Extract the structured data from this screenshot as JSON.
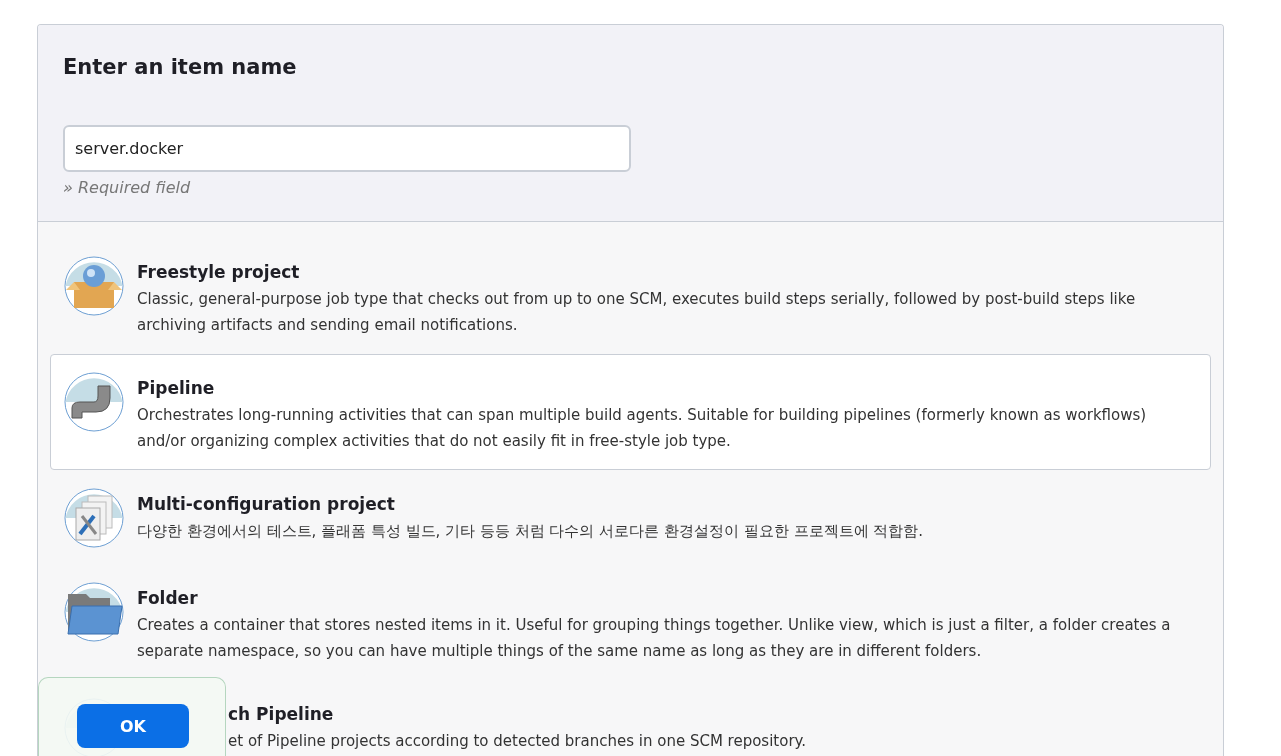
{
  "heading": "Enter an item name",
  "name_field": {
    "value": "server.docker",
    "hint": "» Required field"
  },
  "items": [
    {
      "kind": "freestyle",
      "title": "Freestyle project",
      "description": "Classic, general-purpose job type that checks out from up to one SCM, executes build steps serially, followed by post-build steps like archiving artifacts and sending email notifications.",
      "selected": false
    },
    {
      "kind": "pipeline",
      "title": "Pipeline",
      "description": "Orchestrates long-running activities that can span multiple build agents. Suitable for building pipelines (formerly known as workflows) and/or organizing complex activities that do not easily fit in free-style job type.",
      "selected": true
    },
    {
      "kind": "matrix",
      "title": "Multi-configuration project",
      "description": "다양한 환경에서의 테스트, 플래폼 특성 빌드, 기타 등등 처럼 다수의 서로다른 환경설정이 필요한 프로젝트에 적합함.",
      "selected": false
    },
    {
      "kind": "folder",
      "title": "Folder",
      "description": "Creates a container that stores nested items in it. Useful for grouping things together. Unlike view, which is just a filter, a folder creates a separate namespace, so you can have multiple things of the same name as long as they are in different folders.",
      "selected": false
    },
    {
      "kind": "multibranch",
      "title": "ch Pipeline",
      "description": "et of Pipeline projects according to detected branches in one SCM repository.",
      "selected": false,
      "covered": true
    }
  ],
  "ok_button": "OK"
}
